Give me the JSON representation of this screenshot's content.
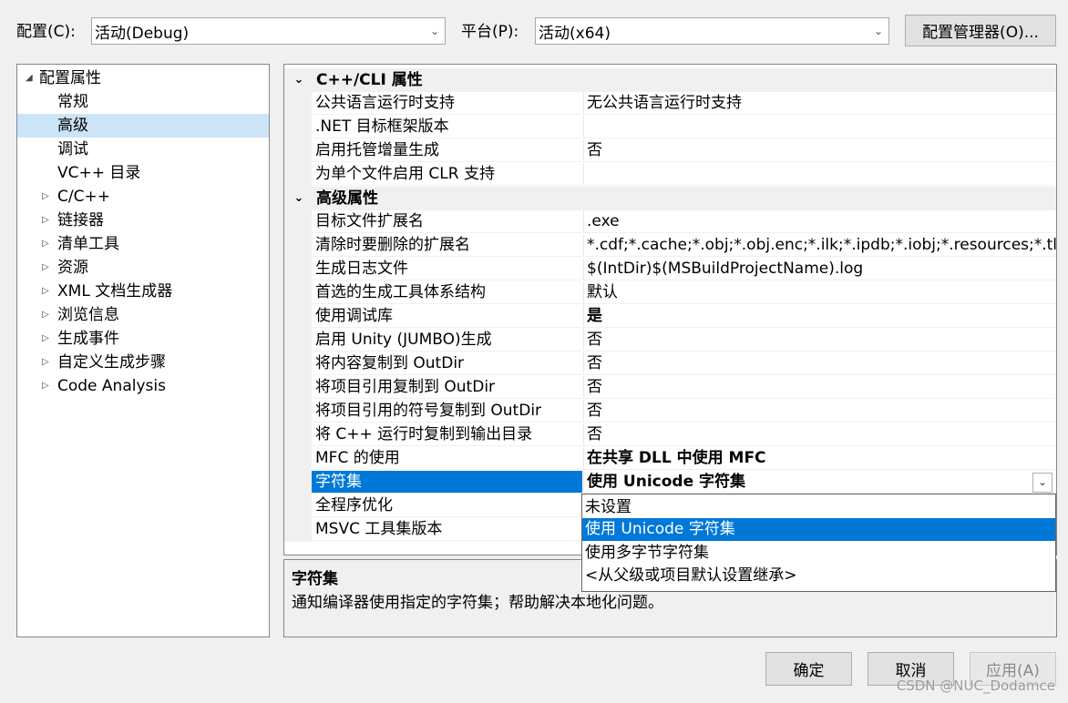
{
  "toolbar": {
    "config_label": "配置(C):",
    "config_value": "活动(Debug)",
    "platform_label": "平台(P):",
    "platform_value": "活动(x64)",
    "config_manager_button": "配置管理器(O)..."
  },
  "tree": {
    "root_label": "配置属性",
    "items": [
      "常规",
      "高级",
      "调试",
      "VC++ 目录",
      "C/C++",
      "链接器",
      "清单工具",
      "资源",
      "XML 文档生成器",
      "浏览信息",
      "生成事件",
      "自定义生成步骤",
      "Code Analysis"
    ],
    "selected": "高级"
  },
  "grid": {
    "categories": [
      "C++/CLI 属性",
      "高级属性"
    ],
    "rows": [
      {
        "name": "公共语言运行时支持",
        "value": "无公共语言运行时支持"
      },
      {
        "name": ".NET 目标框架版本",
        "value": ""
      },
      {
        "name": "启用托管增量生成",
        "value": "否"
      },
      {
        "name": "为单个文件启用 CLR 支持",
        "value": ""
      },
      {
        "name": "目标文件扩展名",
        "value": ".exe"
      },
      {
        "name": "清除时要删除的扩展名",
        "value": "*.cdf;*.cache;*.obj;*.obj.enc;*.ilk;*.ipdb;*.iobj;*.resources;*.tlb;*"
      },
      {
        "name": "生成日志文件",
        "value": "$(IntDir)$(MSBuildProjectName).log"
      },
      {
        "name": "首选的生成工具体系结构",
        "value": "默认"
      },
      {
        "name": "使用调试库",
        "value": "是"
      },
      {
        "name": "启用 Unity (JUMBO)生成",
        "value": "否"
      },
      {
        "name": "将内容复制到 OutDir",
        "value": "否"
      },
      {
        "name": "将项目引用复制到 OutDir",
        "value": "否"
      },
      {
        "name": "将项目引用的符号复制到 OutDir",
        "value": "否"
      },
      {
        "name": "将 C++ 运行时复制到输出目录",
        "value": "否"
      },
      {
        "name": "MFC 的使用",
        "value": "在共享 DLL 中使用 MFC"
      },
      {
        "name": "字符集",
        "value": "使用 Unicode 字符集"
      },
      {
        "name": "全程序优化",
        "value": ""
      },
      {
        "name": "MSVC 工具集版本",
        "value": ""
      }
    ]
  },
  "dropdown": {
    "options": [
      "未设置",
      "使用 Unicode 字符集",
      "使用多字节字符集",
      "<从父级或项目默认设置继承>"
    ],
    "selected": "使用 Unicode 字符集"
  },
  "description": {
    "title": "字符集",
    "text": "通知编译器使用指定的字符集；帮助解决本地化问题。"
  },
  "buttons": {
    "ok": "确定",
    "cancel": "取消",
    "apply": "应用(A)"
  },
  "watermark": "CSDN @NUC_Dodamce"
}
